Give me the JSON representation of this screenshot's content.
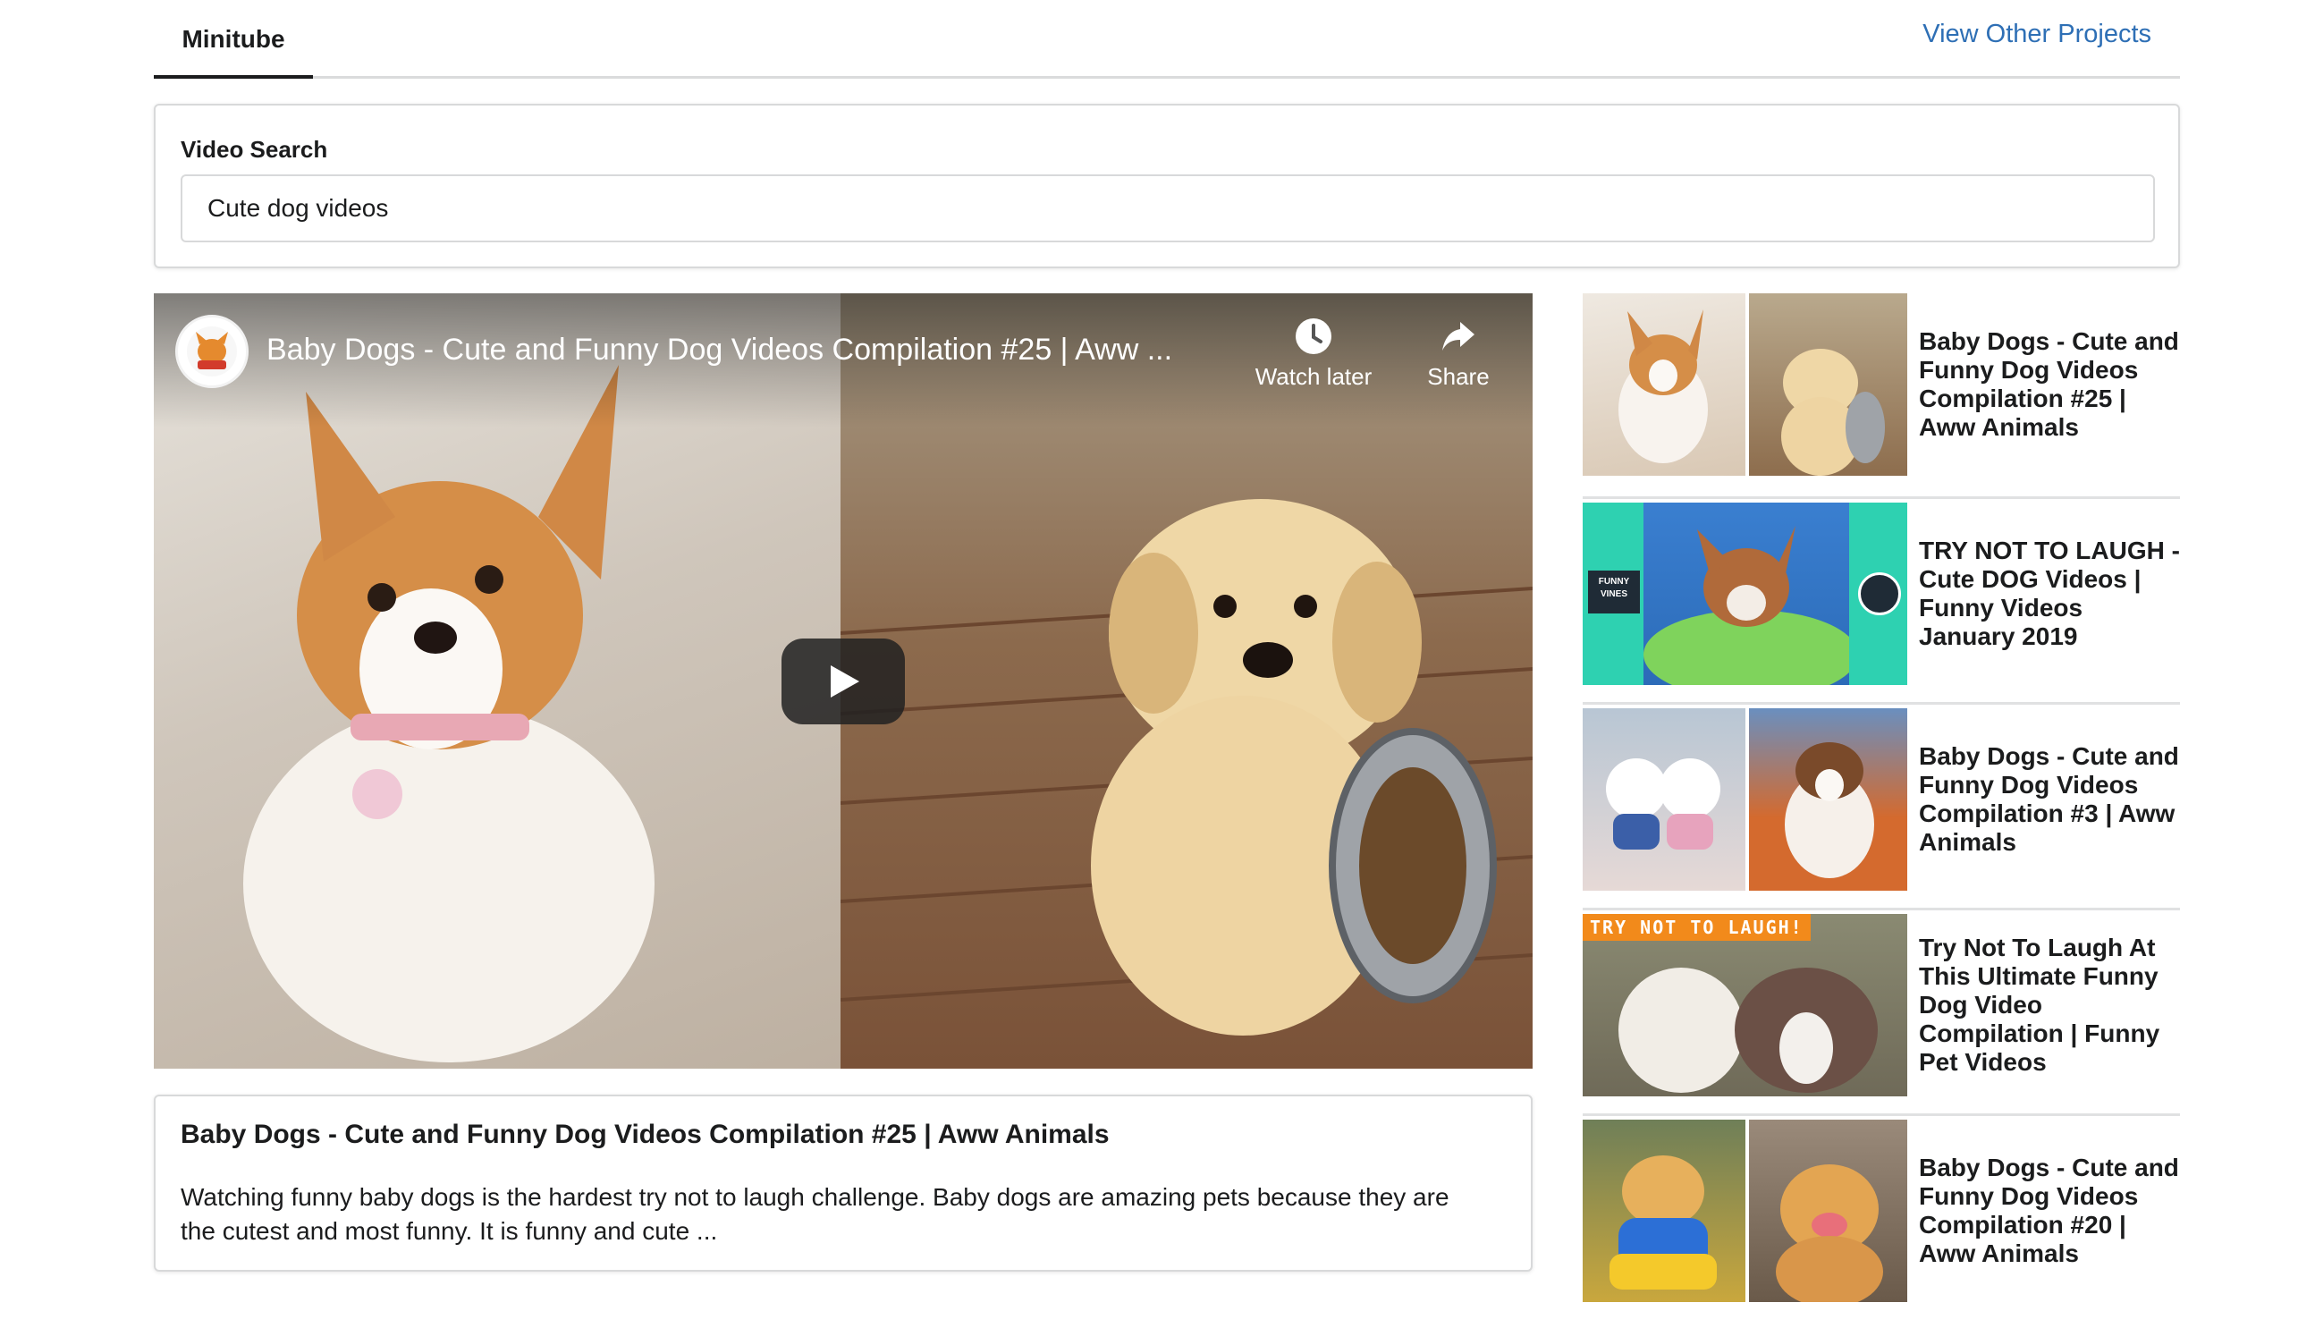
{
  "nav": {
    "tab_label": "Minitube",
    "link_label": "View Other Projects"
  },
  "search": {
    "label": "Video Search",
    "value": "Cute dog videos"
  },
  "player": {
    "title": "Baby Dogs - Cute and Funny Dog Videos Compilation #25 | Aww ...",
    "watch_later_label": "Watch later",
    "share_label": "Share",
    "icons": [
      "clock-icon",
      "share-arrow-icon",
      "play-icon"
    ]
  },
  "selected_video": {
    "title": "Baby Dogs - Cute and Funny Dog Videos Compilation #25 | Aww Animals",
    "description": "Watching funny baby dogs is the hardest try not to laugh challenge. Baby dogs are amazing pets because they are the cutest and most funny. It is funny and cute ..."
  },
  "video_list": [
    {
      "title": "Baby Dogs - Cute and Funny Dog Videos Compilation #25 | Aww Animals"
    },
    {
      "title": "TRY NOT TO LAUGH - Cute DOG Videos | Funny Videos January 2019"
    },
    {
      "title": "Baby Dogs - Cute and Funny Dog Videos Compilation #3 | Aww Animals"
    },
    {
      "title": "Try Not To Laugh At This Ultimate Funny Dog Video Compilation | Funny Pet Videos"
    },
    {
      "title": "Baby Dogs - Cute and Funny Dog Videos Compilation #20 | Aww Animals"
    }
  ],
  "thumb_overlays": {
    "funny_vines": "FUNNY VINES",
    "try_not_to_laugh": "TRY NOT TO LAUGH!"
  },
  "colors": {
    "link": "#2e6fb5",
    "active_tab_border": "#1b1c1d",
    "card_border": "#d8d9da"
  }
}
